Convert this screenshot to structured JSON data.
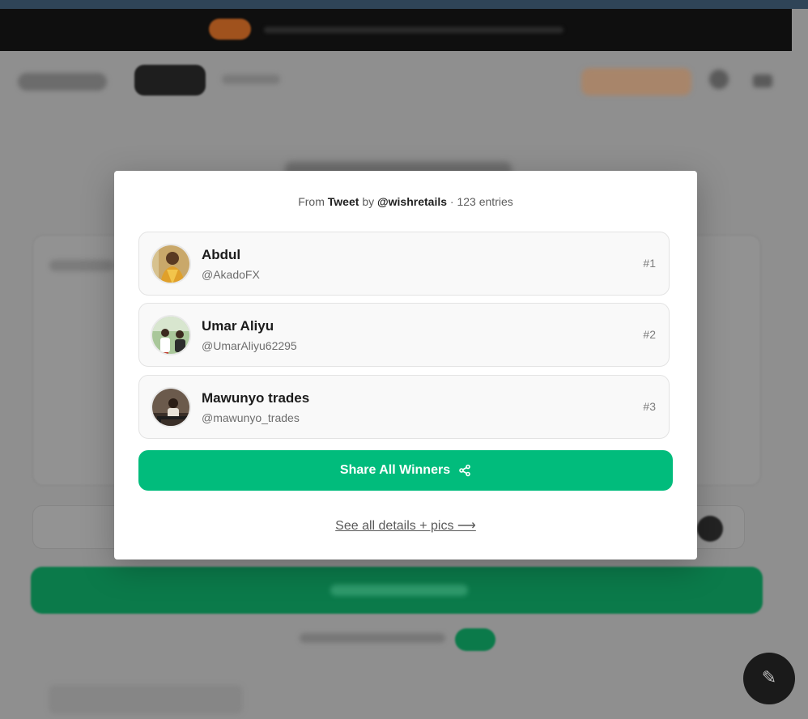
{
  "modal": {
    "source": {
      "prefix": "From",
      "platform": "Tweet",
      "by": "by",
      "handle": "@wishretails",
      "separator": "·",
      "entries": "123 entries"
    },
    "winners": [
      {
        "name": "Abdul",
        "handle": "@AkadoFX",
        "rank": "#1"
      },
      {
        "name": "Umar Aliyu",
        "handle": "@UmarAliyu62295",
        "rank": "#2"
      },
      {
        "name": "Mawunyo trades",
        "handle": "@mawunyo_trades",
        "rank": "#3"
      }
    ],
    "share_button": {
      "label": "Share All Winners",
      "icon": "share-icon"
    },
    "details_link": "See all details + pics ⟶"
  },
  "colors": {
    "accent": "#01bc7c",
    "overlay": "#8f8f8f",
    "modal_bg": "#ffffff"
  }
}
